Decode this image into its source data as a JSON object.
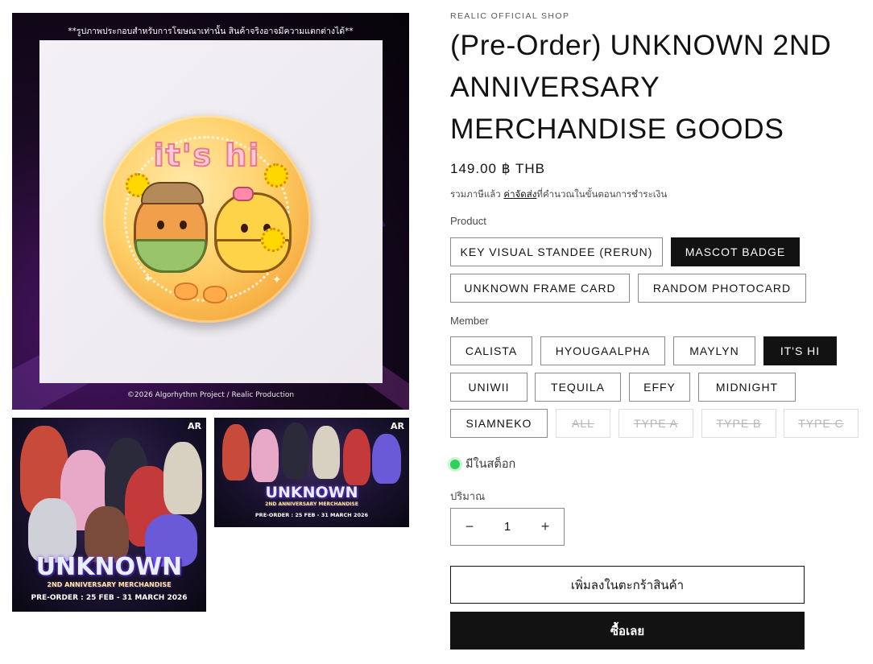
{
  "media": {
    "main_notice": "**รูปภาพประกอบสำหรับการโฆษณาเท่านั้น สินค้าจริงอาจมีความแตกต่างได้**",
    "main_copyright": "©2026 Algorhythm Project / Realic Production",
    "badge_text": "it's hi",
    "thumb1": {
      "logo": "AR",
      "wordmark": "UNKNOWN",
      "subtitle": "2ND ANNIVERSARY MERCHANDISE",
      "preorder": "PRE-ORDER : 25 FEB - 31 MARCH 2026"
    },
    "thumb2": {
      "logo": "AR",
      "wordmark": "UNKNOWN",
      "subtitle": "2ND ANNIVERSARY MERCHANDISE",
      "preorder": "PRE-ORDER : 25 FEB - 31 MARCH 2026"
    }
  },
  "product": {
    "vendor": "REALIC OFFICIAL SHOP",
    "title": "(Pre-Order) UNKNOWN 2ND\nANNIVERSARY\nMERCHANDISE GOODS",
    "price": "149.00 ฿ THB",
    "tax_note_prefix": "รวมภาษีแล้ว ",
    "tax_note_link": "ค่าจัดส่ง",
    "tax_note_suffix": "ที่คำนวณในขั้นตอนการชำระเงิน"
  },
  "options": {
    "product_label": "Product",
    "product_values": [
      {
        "label": "KEY VISUAL STANDEE (RERUN)",
        "state": "normal"
      },
      {
        "label": "MASCOT BADGE",
        "state": "selected"
      },
      {
        "label": "UNKNOWN FRAME CARD",
        "state": "normal"
      },
      {
        "label": "RANDOM PHOTOCARD",
        "state": "normal"
      }
    ],
    "member_label": "Member",
    "member_values": [
      {
        "label": "CALISTA",
        "state": "normal"
      },
      {
        "label": "HYOUGAALPHA",
        "state": "normal"
      },
      {
        "label": "MAYLYN",
        "state": "normal"
      },
      {
        "label": "IT'S HI",
        "state": "selected"
      },
      {
        "label": "UNIWII",
        "state": "normal"
      },
      {
        "label": "TEQUILA",
        "state": "normal"
      },
      {
        "label": "EFFY",
        "state": "normal"
      },
      {
        "label": "MIDNIGHT",
        "state": "normal"
      },
      {
        "label": "SIAMNEKO",
        "state": "normal"
      },
      {
        "label": "ALL",
        "state": "disabled"
      },
      {
        "label": "TYPE A",
        "state": "disabled"
      },
      {
        "label": "TYPE B",
        "state": "disabled"
      },
      {
        "label": "TYPE C",
        "state": "disabled"
      }
    ]
  },
  "stock": {
    "text": "มีในสต็อก",
    "color": "#2ed15a"
  },
  "quantity": {
    "label": "ปริมาณ",
    "value": "1",
    "minus": "−",
    "plus": "+"
  },
  "actions": {
    "add_to_cart": "เพิ่มลงในตะกร้าสินค้า",
    "buy_now": "ซื้อเลย"
  },
  "colors": {
    "accent": "#121212",
    "in_stock": "#2ed15a"
  }
}
